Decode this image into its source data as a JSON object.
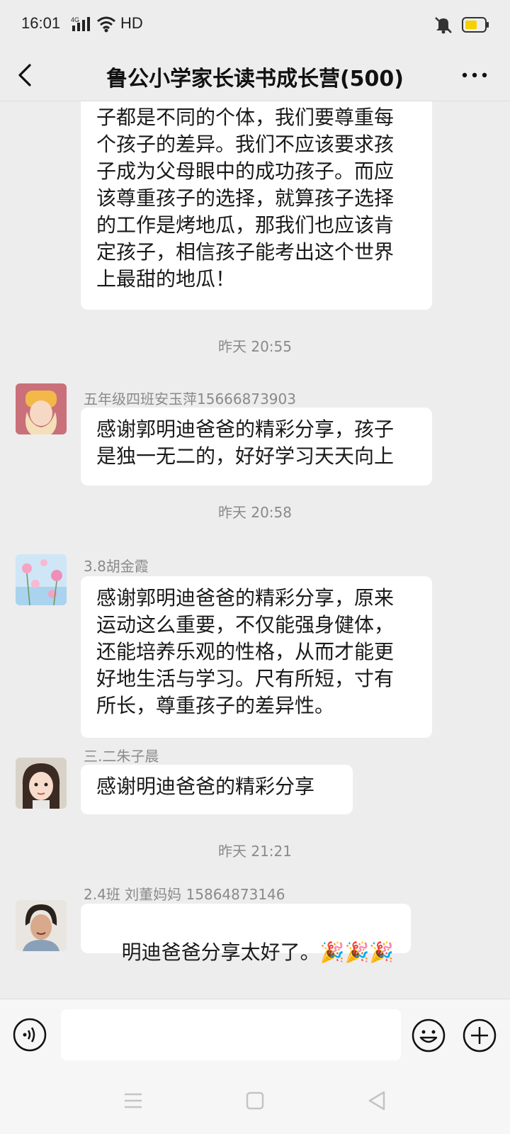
{
  "status_bar": {
    "time": "16:01",
    "signal_label": "4G",
    "hd_label": "HD",
    "battery_color": "#f7d000"
  },
  "nav": {
    "title": "鲁公小学家长读书成长营(500)",
    "back_icon": "chevron-left-icon",
    "more_icon": "more-dots-icon"
  },
  "messages": [
    {
      "text": "子都是不同的个体，我们要尊重每\n个孩子的差异。我们不应该要求孩\n子成为父母眼中的成功孩子。而应\n该尊重孩子的选择，就算孩子选择\n的工作是烤地瓜，那我们也应该肯\n定孩子，相信孩子能考出这个世界\n上最甜的地瓜！"
    },
    {
      "timestamp": "昨天 20:55"
    },
    {
      "sender": "五年级四班安玉萍15666873903",
      "text": "感谢郭明迪爸爸的精彩分享，孩子\n是独一无二的，好好学习天天向上"
    },
    {
      "timestamp": "昨天 20:58"
    },
    {
      "sender": "3.8胡金霞",
      "text": "感谢郭明迪爸爸的精彩分享，原来\n运动这么重要，不仅能强身健体，\n还能培养乐观的性格，从而才能更\n好地生活与学习。尺有所短，寸有\n所长，尊重孩子的差异性。"
    },
    {
      "sender": "三.二朱子晨",
      "text": "感谢明迪爸爸的精彩分享"
    },
    {
      "timestamp": "昨天 21:21"
    },
    {
      "sender": "2.4班 刘董妈妈 15864873146",
      "text": "明迪爸爸分享太好了。",
      "emoji": "🎉🎉🎉"
    }
  ],
  "input": {
    "voice_icon": "voice-icon",
    "emoji_icon": "smiley-icon",
    "plus_icon": "plus-circle-icon"
  },
  "system_nav": {
    "menu_icon": "menu-icon",
    "home_icon": "home-square-icon",
    "back_icon": "back-triangle-icon"
  }
}
